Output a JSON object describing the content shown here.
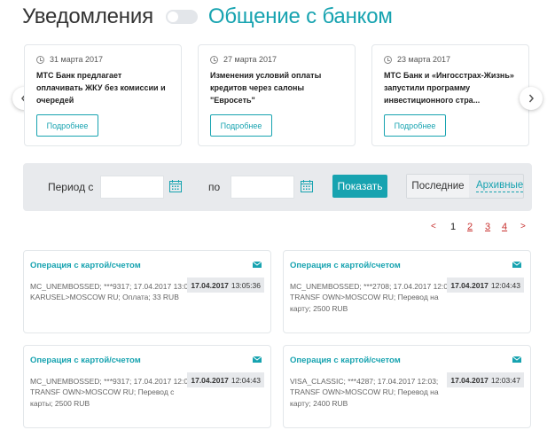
{
  "header": {
    "title": "Уведомления",
    "link": "Общение с банком"
  },
  "news": [
    {
      "date": "31 марта 2017",
      "text": "МТС Банк предлагает оплачивать ЖКУ без комиссии и очередей",
      "more": "Подробнее"
    },
    {
      "date": "27 марта 2017",
      "text": "Изменения условий оплаты кредитов через салоны \"Евросеть\"",
      "more": "Подробнее"
    },
    {
      "date": "23 марта 2017",
      "text": "МТС Банк и «Ингосстрах-Жизнь» запустили программу инвестиционного стра...",
      "more": "Подробнее"
    }
  ],
  "icons": {
    "clock": "clock-icon",
    "calendar": "calendar-icon",
    "mail": "mail-icon",
    "arrow_left": "chevron-left-icon",
    "arrow_right": "chevron-right-icon"
  },
  "filter": {
    "period_from_label": "Период с",
    "from_value": "",
    "to_label": "по",
    "to_value": "",
    "show_button": "Показать",
    "last_label": "Последние",
    "archive_label": "Архивные"
  },
  "pagination": {
    "prev": "<",
    "current": "1",
    "pages": [
      "2",
      "3",
      "4"
    ],
    "next": ">"
  },
  "operations": [
    {
      "title": "Операция с картой/счетом",
      "desc": "MC_UNEMBOSSED; ***9317; 17.04.2017 13:05; KARUSEL>MOSCOW RU; Оплата; 33 RUB",
      "date": "17.04.2017",
      "time": "13:05:36"
    },
    {
      "title": "Операция с картой/счетом",
      "desc": "MC_UNEMBOSSED; ***2708; 17.04.2017 12:04; TRANSF OWN>MOSCOW RU; Перевод на карту; 2500 RUB",
      "date": "17.04.2017",
      "time": "12:04:43"
    },
    {
      "title": "Операция с картой/счетом",
      "desc": "MC_UNEMBOSSED; ***9317; 17.04.2017 12:04; TRANSF OWN>MOSCOW RU; Перевод с карты; 2500 RUB",
      "date": "17.04.2017",
      "time": "12:04:43"
    },
    {
      "title": "Операция с картой/счетом",
      "desc": "VISA_CLASSIC; ***4287; 17.04.2017 12:03; TRANSF OWN>MOSCOW RU; Перевод на карту; 2400 RUB",
      "date": "17.04.2017",
      "time": "12:03:47"
    }
  ],
  "colors": {
    "accent": "#17a3b0",
    "pager_link": "#c8312f",
    "filter_bg": "#e8eaed"
  }
}
